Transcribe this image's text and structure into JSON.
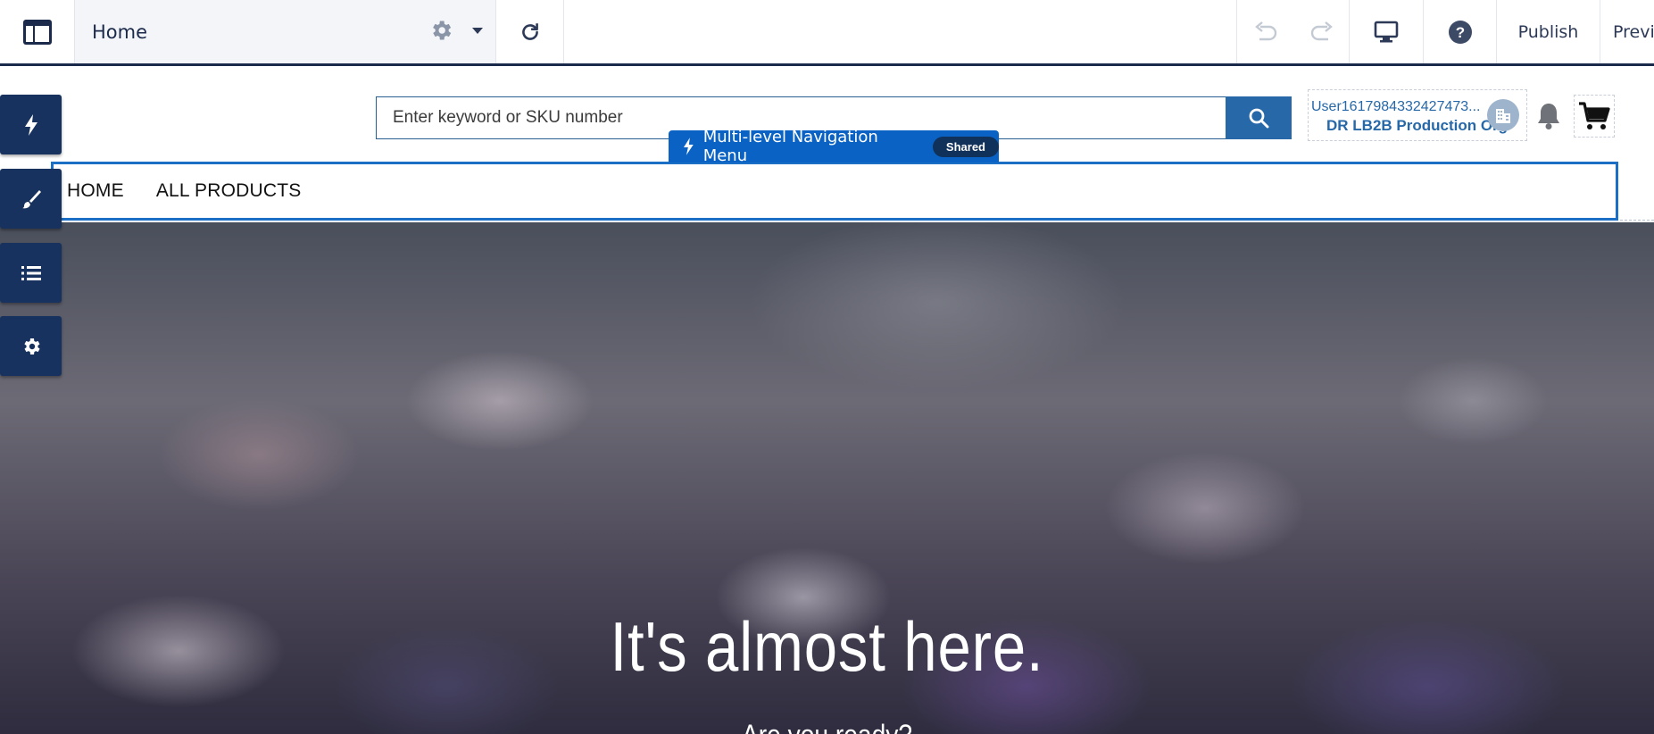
{
  "builder": {
    "page_name": "Home",
    "publish_label": "Publish",
    "preview_label": "Previ"
  },
  "rail": {
    "items": [
      "lightning-icon",
      "brush-icon",
      "list-icon",
      "gear-icon"
    ]
  },
  "search": {
    "placeholder": "Enter keyword or SKU number"
  },
  "account": {
    "user_name": "User1617984332427473...",
    "org_name": "DR LB2B Production Org"
  },
  "component_tag": {
    "label": "Multi-level Navigation Menu",
    "badge": "Shared"
  },
  "nav": {
    "items": [
      "HOME",
      "ALL PRODUCTS"
    ]
  },
  "hero": {
    "title": "It's almost here.",
    "subtitle": "Are you ready?"
  },
  "colors": {
    "builder_navy": "#1b2a4a",
    "rail_blue": "#17325e",
    "brand_blue": "#2668a8",
    "selection_blue": "#0a63c4"
  }
}
